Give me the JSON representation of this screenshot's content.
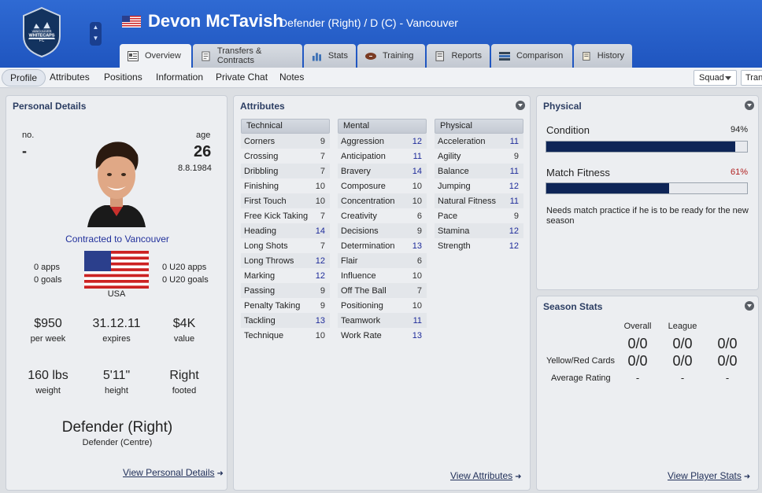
{
  "header": {
    "player_name": "Devon McTavish",
    "player_sub": "Defender (Right) / D (C) - Vancouver",
    "crest_text": "VANCOUVER WHITECAPS FC"
  },
  "tabs": [
    {
      "label": "Overview",
      "icon": "overview-icon",
      "active": true
    },
    {
      "label": "Transfers & Contracts",
      "icon": "contract-icon"
    },
    {
      "label": "Stats",
      "icon": "stats-icon"
    },
    {
      "label": "Training",
      "icon": "ball-icon"
    },
    {
      "label": "Reports",
      "icon": "report-icon"
    },
    {
      "label": "Comparison",
      "icon": "comparison-icon"
    },
    {
      "label": "History",
      "icon": "history-icon"
    }
  ],
  "subnav": {
    "items": [
      "Profile",
      "Attributes",
      "Positions",
      "Information",
      "Private Chat",
      "Notes"
    ],
    "squad": "Squad",
    "trans": "Trans"
  },
  "personal": {
    "title": "Personal Details",
    "no_label": "no.",
    "no_value": "-",
    "age_label": "age",
    "age_value": "26",
    "dob": "8.8.1984",
    "contract": "Contracted to Vancouver",
    "apps": "0 apps",
    "goals": "0 goals",
    "u20_apps": "0 U20 apps",
    "u20_goals": "0 U20 goals",
    "nation": "USA",
    "wage": "$950",
    "wage_label": "per week",
    "expires": "31.12.11",
    "expires_label": "expires",
    "value": "$4K",
    "value_label": "value",
    "weight": "160 lbs",
    "weight_label": "weight",
    "height": "5'11\"",
    "height_label": "height",
    "foot": "Right",
    "foot_label": "footed",
    "position": "Defender (Right)",
    "position_sub": "Defender (Centre)",
    "link": "View Personal Details"
  },
  "attributes": {
    "title": "Attributes",
    "link": "View Attributes",
    "technical": {
      "label": "Technical",
      "rows": [
        [
          "Corners",
          "9"
        ],
        [
          "Crossing",
          "7"
        ],
        [
          "Dribbling",
          "7"
        ],
        [
          "Finishing",
          "10"
        ],
        [
          "First Touch",
          "10"
        ],
        [
          "Free Kick Taking",
          "7"
        ],
        [
          "Heading",
          "14"
        ],
        [
          "Long Shots",
          "7"
        ],
        [
          "Long Throws",
          "12"
        ],
        [
          "Marking",
          "12"
        ],
        [
          "Passing",
          "9"
        ],
        [
          "Penalty Taking",
          "9"
        ],
        [
          "Tackling",
          "13"
        ],
        [
          "Technique",
          "10"
        ]
      ]
    },
    "mental": {
      "label": "Mental",
      "rows": [
        [
          "Aggression",
          "12"
        ],
        [
          "Anticipation",
          "11"
        ],
        [
          "Bravery",
          "14"
        ],
        [
          "Composure",
          "10"
        ],
        [
          "Concentration",
          "10"
        ],
        [
          "Creativity",
          "6"
        ],
        [
          "Decisions",
          "9"
        ],
        [
          "Determination",
          "13"
        ],
        [
          "Flair",
          "6"
        ],
        [
          "Influence",
          "10"
        ],
        [
          "Off The Ball",
          "7"
        ],
        [
          "Positioning",
          "10"
        ],
        [
          "Teamwork",
          "11"
        ],
        [
          "Work Rate",
          "13"
        ]
      ]
    },
    "physical": {
      "label": "Physical",
      "rows": [
        [
          "Acceleration",
          "11"
        ],
        [
          "Agility",
          "9"
        ],
        [
          "Balance",
          "11"
        ],
        [
          "Jumping",
          "12"
        ],
        [
          "Natural Fitness",
          "11"
        ],
        [
          "Pace",
          "9"
        ],
        [
          "Stamina",
          "12"
        ],
        [
          "Strength",
          "12"
        ]
      ]
    }
  },
  "physical": {
    "title": "Physical",
    "condition_label": "Condition",
    "condition_value": "94%",
    "condition_fraction": 0.94,
    "fitness_label": "Match Fitness",
    "fitness_value": "61%",
    "fitness_fraction": 0.61,
    "note": "Needs match practice if he is to be ready for the new season"
  },
  "season": {
    "title": "Season Stats",
    "col_overall": "Overall",
    "col_league": "League",
    "row1": [
      "0/0",
      "0/0",
      "0/0"
    ],
    "row2_label": "Yellow/Red Cards",
    "row2": [
      "0/0",
      "0/0",
      "0/0"
    ],
    "row3_label": "Average Rating",
    "row3": [
      "-",
      "-",
      "-"
    ],
    "link": "View Player Stats"
  },
  "colors": {
    "header_blue": "#2563c9",
    "bar_fill": "#0e2557",
    "highlight_value": "#1e2b9a",
    "warning": "#b02020"
  }
}
